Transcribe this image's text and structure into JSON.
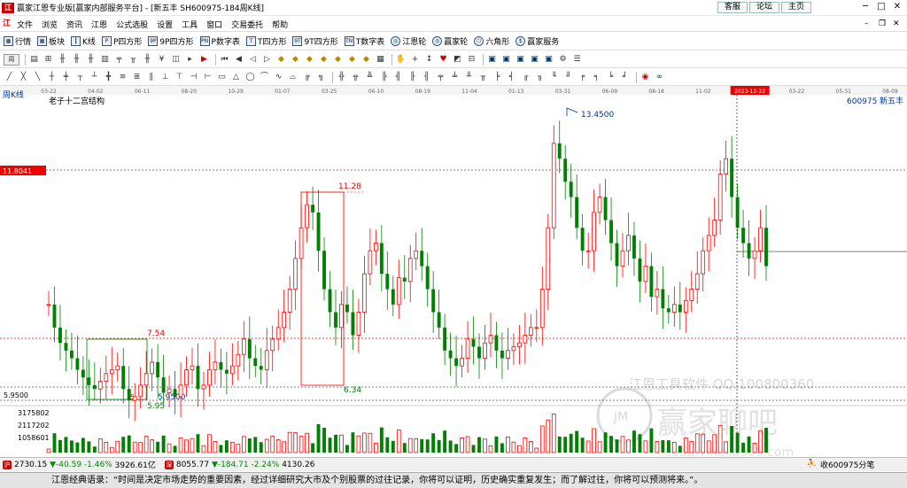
{
  "window": {
    "title": "赢家江恩专业版[赢家内部服务平台] - [新五丰  SH600975-184周K线]",
    "links": [
      "客服",
      "论坛",
      "主页"
    ]
  },
  "menu": [
    "文件",
    "浏览",
    "资讯",
    "江恩",
    "公式选股",
    "设置",
    "工具",
    "窗口",
    "交易委托",
    "帮助"
  ],
  "toolbar1": [
    {
      "label": "行情",
      "icon": "grid-icon"
    },
    {
      "label": "板块",
      "icon": "grid-icon"
    },
    {
      "label": "K线",
      "icon": "candle-icon"
    },
    {
      "label": "P四方形",
      "icon": "square-icon"
    },
    {
      "label": "9P四方形",
      "icon": "square-icon"
    },
    {
      "label": "P数字表",
      "icon": "square-icon"
    },
    {
      "label": "T四方形",
      "icon": "square-icon"
    },
    {
      "label": "9T四方形",
      "icon": "square-icon"
    },
    {
      "label": "T数字表",
      "icon": "square-icon"
    },
    {
      "label": "江恩轮",
      "icon": "wheel-icon"
    },
    {
      "label": "赢家轮",
      "icon": "wheel-icon"
    },
    {
      "label": "六角形",
      "icon": "hexagon-icon"
    },
    {
      "label": "赢家服务",
      "icon": "dollar-icon"
    }
  ],
  "toolbar2": {
    "period": "周"
  },
  "chart": {
    "period_label": "周K线",
    "indicator_name": "老子十二宫结构",
    "stock_code": "600975",
    "stock_name": "新五丰",
    "price_marker": "11.8041",
    "y_left_labels": [
      "5.9500",
      "3175802",
      "2117202",
      "1058601"
    ],
    "date_ticks": [
      "03-22",
      "04-02",
      "06-11",
      "08-20",
      "10-29",
      "01-07",
      "03-25",
      "06-10",
      "08-19",
      "11-04",
      "01-13",
      "03-31",
      "06-09",
      "08-18",
      "11-02",
      "2023-12-22",
      "03-22",
      "05-31",
      "08-09"
    ],
    "highlight_date": "2023-12-22",
    "annotations": {
      "high": "13.4500",
      "box_top": "11.28",
      "box_bottom": "6.34",
      "level_mid": "7.54",
      "low": "5.95",
      "low2": "5.9500",
      "five": "5"
    },
    "watermark1": "江恩工具软件  QQ:100800360",
    "watermark2": "赢家聊吧",
    "watermark3": "liaoba.yingjia360.com",
    "colors": {
      "up": "#ff0000",
      "down": "#008000",
      "marker": "#ff0000",
      "level": "#ff0000"
    }
  },
  "chart_data": {
    "type": "candlestick",
    "title": "老子十二宫结构",
    "close": [
      8.4,
      7.8,
      7.4,
      7.2,
      7.0,
      6.7,
      6.5,
      6.3,
      6.2,
      6.4,
      6.6,
      6.7,
      6.8,
      6.2,
      5.9,
      6.0,
      6.3,
      6.6,
      6.9,
      6.5,
      6.1,
      6.2,
      6.0,
      6.3,
      6.7,
      6.8,
      6.2,
      6.3,
      6.7,
      6.9,
      6.7,
      6.6,
      6.8,
      7.1,
      7.5,
      7.0,
      6.8,
      6.7,
      7.2,
      7.5,
      7.8,
      8.2,
      8.8,
      9.6,
      10.4,
      11.0,
      10.8,
      9.8,
      8.8,
      8.2,
      7.8,
      8.4,
      8.2,
      7.6,
      8.2,
      9.2,
      9.8,
      10.0,
      9.2,
      8.8,
      8.4,
      9.1,
      9.0,
      9.6,
      9.8,
      9.4,
      8.8,
      8.2,
      7.8,
      7.2,
      7.0,
      6.8,
      7.0,
      7.5,
      7.3,
      7.0,
      7.4,
      7.6,
      7.2,
      7.0,
      7.2,
      7.3,
      7.4,
      7.6,
      7.8,
      7.8,
      8.8,
      10.4,
      12.6,
      12.2,
      11.6,
      11.2,
      10.4,
      9.8,
      9.8,
      10.8,
      11.2,
      10.6,
      10.0,
      9.4,
      9.8,
      10.2,
      9.6,
      9.0,
      9.4,
      8.6,
      8.8,
      8.3,
      8.2,
      8.4,
      8.2,
      8.5,
      8.8,
      9.2,
      9.8,
      10.2,
      10.6,
      11.8,
      12.2,
      11.2,
      10.4,
      10.0,
      9.6,
      9.8,
      10.4,
      9.4
    ]
  },
  "status": {
    "index1": {
      "icon": "沪",
      "value": "2730.15",
      "change": "▼-40.59",
      "pct": "-1.46%",
      "amount": "3926.61亿"
    },
    "index2": {
      "icon": "深",
      "value": "8055.77",
      "change": "▼-184.71",
      "pct": "-2.24%",
      "amount": "4130.26"
    },
    "right_text": "收600975分笔"
  },
  "quote": "江恩经典语录：“时间是决定市场走势的重要因素，经过详细研究大市及个别股票的过往记录，你将可以证明，历史确实重复发生；而了解过往，你将可以预测将来。”。"
}
